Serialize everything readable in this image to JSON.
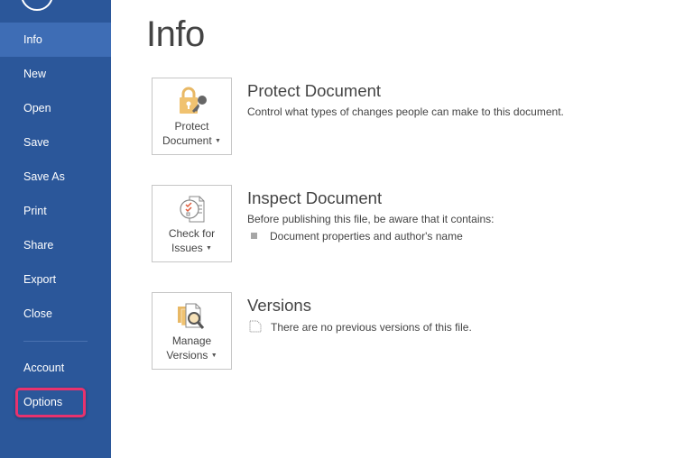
{
  "sidebar": {
    "back_icon": "back-arrow-circle-icon",
    "items": [
      {
        "label": "Info",
        "active": true
      },
      {
        "label": "New"
      },
      {
        "label": "Open"
      },
      {
        "label": "Save"
      },
      {
        "label": "Save As"
      },
      {
        "label": "Print"
      },
      {
        "label": "Share"
      },
      {
        "label": "Export"
      },
      {
        "label": "Close"
      },
      {
        "label": "Account"
      },
      {
        "label": "Options",
        "highlighted": true
      }
    ],
    "highlight_color": "#e8326e"
  },
  "main": {
    "title": "Info",
    "sections": [
      {
        "button_line1": "Protect",
        "button_line2": "Document",
        "icon": "lock-key-icon",
        "title": "Protect Document",
        "description": "Control what types of changes people can make to this document."
      },
      {
        "button_line1": "Check for",
        "button_line2": "Issues",
        "icon": "checklist-document-icon",
        "title": "Inspect Document",
        "description": "Before publishing this file, be aware that it contains:",
        "bullets": [
          "Document properties and author's name"
        ]
      },
      {
        "button_line1": "Manage",
        "button_line2": "Versions",
        "icon": "versions-magnifier-icon",
        "title": "Versions",
        "description": "There are no previous versions of this file."
      }
    ]
  },
  "colors": {
    "sidebar_bg": "#2b579a",
    "sidebar_active": "#3e6db5"
  }
}
